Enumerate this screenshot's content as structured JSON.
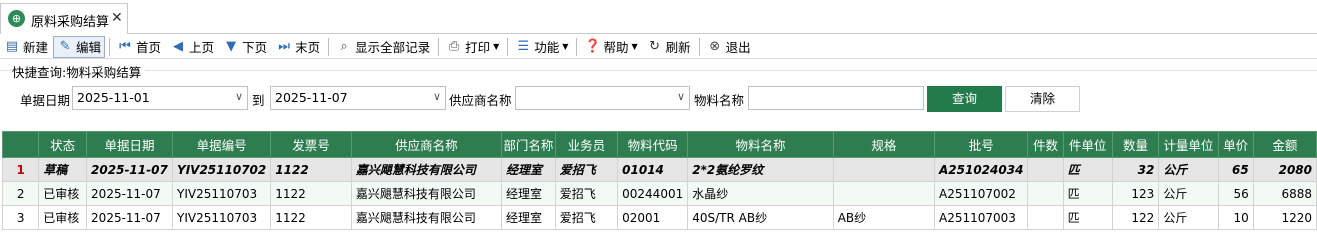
{
  "tab": {
    "title": "原料采购结算",
    "close": "✕"
  },
  "toolbar": {
    "new": "新建",
    "edit": "编辑",
    "first": "首页",
    "prev": "上页",
    "next": "下页",
    "last": "末页",
    "show_all": "显示全部记录",
    "print": "打印",
    "function": "功能",
    "help": "帮助",
    "refresh": "刷新",
    "exit": "退出"
  },
  "query": {
    "title": "快捷查询:物料采购结算",
    "date_label": "单据日期",
    "date_from": "2025-11-01",
    "to_label": "到",
    "date_to": "2025-11-07",
    "supplier_label": "供应商名称",
    "supplier_value": "",
    "material_label": "物料名称",
    "material_value": "",
    "query_button": "查询",
    "clear_button": "清除"
  },
  "grid": {
    "headers": [
      "",
      "状态",
      "单据日期",
      "单据编号",
      "发票号",
      "供应商名称",
      "部门名称",
      "业务员",
      "物料代码",
      "物料名称",
      "规格",
      "批号",
      "件数",
      "件单位",
      "数量",
      "计量单位",
      "单价",
      "金额"
    ],
    "rows": [
      [
        "1",
        "草稿",
        "2025-11-07",
        "YIV25110702",
        "1122",
        "嘉兴飓慧科技有限公司",
        "经理室",
        "爱招飞",
        "01014",
        "2*2氨纶罗纹",
        "",
        "A251024034",
        "",
        "匹",
        "32",
        "公斤",
        "65",
        "2080"
      ],
      [
        "2",
        "已审核",
        "2025-11-07",
        "YIV25110703",
        "1122",
        "嘉兴飓慧科技有限公司",
        "经理室",
        "爱招飞",
        "00244001",
        "水晶纱",
        "",
        "A251107002",
        "",
        "匹",
        "123",
        "公斤",
        "56",
        "6888"
      ],
      [
        "3",
        "已审核",
        "2025-11-07",
        "YIV25110703",
        "1122",
        "嘉兴飓慧科技有限公司",
        "经理室",
        "爱招飞",
        "02001",
        "40S/TR AB纱",
        "AB纱",
        "A251107003",
        "",
        "匹",
        "122",
        "公斤",
        "10",
        "1220"
      ]
    ]
  },
  "colors": {
    "header_green": "#2e7d50",
    "query_button": "#237a4b",
    "draft_row_num": "#c00000"
  }
}
